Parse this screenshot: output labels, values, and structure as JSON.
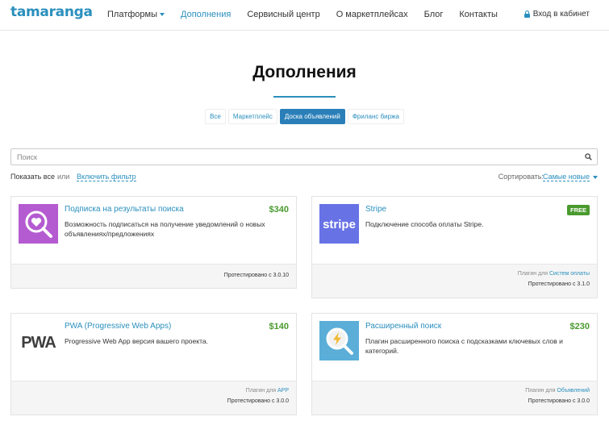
{
  "header": {
    "logo": "tamaranga",
    "nav": [
      {
        "label": "Платформы",
        "dropdown": true,
        "active": false
      },
      {
        "label": "Дополнения",
        "dropdown": false,
        "active": true
      },
      {
        "label": "Сервисный центр",
        "dropdown": false,
        "active": false
      },
      {
        "label": "О маркетплейсах",
        "dropdown": false,
        "active": false
      },
      {
        "label": "Блог",
        "dropdown": false,
        "active": false
      },
      {
        "label": "Контакты",
        "dropdown": false,
        "active": false
      }
    ],
    "login_label": "Вход в кабинет"
  },
  "page": {
    "title": "Дополнения"
  },
  "tabs": [
    {
      "label": "Все",
      "active": false
    },
    {
      "label": "Маркетплейс",
      "active": false
    },
    {
      "label": "Доска объявлений",
      "active": true
    },
    {
      "label": "Фриланс биржа",
      "active": false
    }
  ],
  "search": {
    "placeholder": "Поиск",
    "value": ""
  },
  "filter": {
    "show_all": "Показать все",
    "or": "или",
    "enable_filter": "Включить фильтр",
    "sort_label": "Сортировать:",
    "sort_value": "Самые новые"
  },
  "cards": [
    {
      "name": "Подписка на результаты поиска",
      "price": "$340",
      "description": "Возможность подписаться на получение уведомлений о новых объявлениях/предложениях",
      "plugin_for_label": "",
      "plugin_for_link": "",
      "tested": "Протестировано с 3.0.10",
      "icon": "heart-search-icon"
    },
    {
      "name": "Stripe",
      "price": "FREE",
      "description": "Подключение способа оплаты Stripe.",
      "plugin_for_label": "Плагин для",
      "plugin_for_link": "Систем оплаты",
      "tested": "Протестировано с 3.1.0",
      "icon": "stripe-logo",
      "logo_text": "stripe"
    },
    {
      "name": "PWA (Progressive Web Apps)",
      "price": "$140",
      "description": "Progressive Web App версия вашего проекта.",
      "plugin_for_label": "Плагин для",
      "plugin_for_link": "APP",
      "tested": "Протестировано с 3.0.0",
      "icon": "pwa-logo",
      "logo_text": "PWA"
    },
    {
      "name": "Расширенный поиск",
      "price": "$230",
      "description": "Плагин расширенного поиска с подсказками ключевых слов и категорий.",
      "plugin_for_label": "Плагин для",
      "plugin_for_link": "Объявлений",
      "tested": "Протестировано с 3.0.0",
      "icon": "lightning-search-icon"
    }
  ],
  "colors": {
    "accent": "#2a8fbd",
    "price": "#4a9a2e",
    "heart_bg": "#b45bd1",
    "stripe_bg": "#6772e5",
    "search_bg": "#5aaed8"
  }
}
